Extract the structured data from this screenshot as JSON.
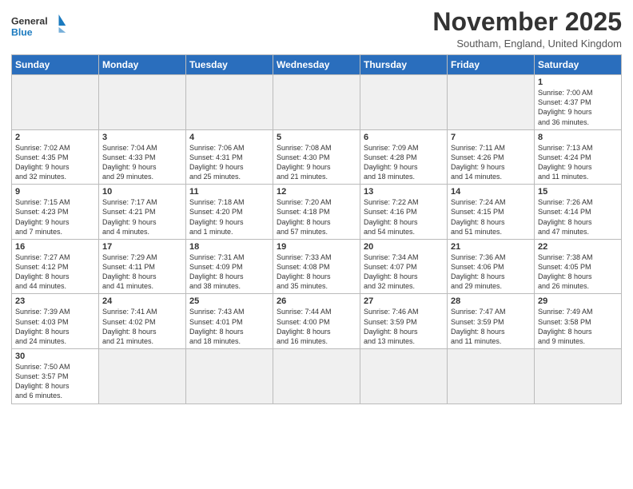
{
  "header": {
    "logo_general": "General",
    "logo_blue": "Blue",
    "title": "November 2025",
    "subtitle": "Southam, England, United Kingdom"
  },
  "days_of_week": [
    "Sunday",
    "Monday",
    "Tuesday",
    "Wednesday",
    "Thursday",
    "Friday",
    "Saturday"
  ],
  "weeks": [
    [
      {
        "day": "",
        "info": ""
      },
      {
        "day": "",
        "info": ""
      },
      {
        "day": "",
        "info": ""
      },
      {
        "day": "",
        "info": ""
      },
      {
        "day": "",
        "info": ""
      },
      {
        "day": "",
        "info": ""
      },
      {
        "day": "1",
        "info": "Sunrise: 7:00 AM\nSunset: 4:37 PM\nDaylight: 9 hours\nand 36 minutes."
      }
    ],
    [
      {
        "day": "2",
        "info": "Sunrise: 7:02 AM\nSunset: 4:35 PM\nDaylight: 9 hours\nand 32 minutes."
      },
      {
        "day": "3",
        "info": "Sunrise: 7:04 AM\nSunset: 4:33 PM\nDaylight: 9 hours\nand 29 minutes."
      },
      {
        "day": "4",
        "info": "Sunrise: 7:06 AM\nSunset: 4:31 PM\nDaylight: 9 hours\nand 25 minutes."
      },
      {
        "day": "5",
        "info": "Sunrise: 7:08 AM\nSunset: 4:30 PM\nDaylight: 9 hours\nand 21 minutes."
      },
      {
        "day": "6",
        "info": "Sunrise: 7:09 AM\nSunset: 4:28 PM\nDaylight: 9 hours\nand 18 minutes."
      },
      {
        "day": "7",
        "info": "Sunrise: 7:11 AM\nSunset: 4:26 PM\nDaylight: 9 hours\nand 14 minutes."
      },
      {
        "day": "8",
        "info": "Sunrise: 7:13 AM\nSunset: 4:24 PM\nDaylight: 9 hours\nand 11 minutes."
      }
    ],
    [
      {
        "day": "9",
        "info": "Sunrise: 7:15 AM\nSunset: 4:23 PM\nDaylight: 9 hours\nand 7 minutes."
      },
      {
        "day": "10",
        "info": "Sunrise: 7:17 AM\nSunset: 4:21 PM\nDaylight: 9 hours\nand 4 minutes."
      },
      {
        "day": "11",
        "info": "Sunrise: 7:18 AM\nSunset: 4:20 PM\nDaylight: 9 hours\nand 1 minute."
      },
      {
        "day": "12",
        "info": "Sunrise: 7:20 AM\nSunset: 4:18 PM\nDaylight: 8 hours\nand 57 minutes."
      },
      {
        "day": "13",
        "info": "Sunrise: 7:22 AM\nSunset: 4:16 PM\nDaylight: 8 hours\nand 54 minutes."
      },
      {
        "day": "14",
        "info": "Sunrise: 7:24 AM\nSunset: 4:15 PM\nDaylight: 8 hours\nand 51 minutes."
      },
      {
        "day": "15",
        "info": "Sunrise: 7:26 AM\nSunset: 4:14 PM\nDaylight: 8 hours\nand 47 minutes."
      }
    ],
    [
      {
        "day": "16",
        "info": "Sunrise: 7:27 AM\nSunset: 4:12 PM\nDaylight: 8 hours\nand 44 minutes."
      },
      {
        "day": "17",
        "info": "Sunrise: 7:29 AM\nSunset: 4:11 PM\nDaylight: 8 hours\nand 41 minutes."
      },
      {
        "day": "18",
        "info": "Sunrise: 7:31 AM\nSunset: 4:09 PM\nDaylight: 8 hours\nand 38 minutes."
      },
      {
        "day": "19",
        "info": "Sunrise: 7:33 AM\nSunset: 4:08 PM\nDaylight: 8 hours\nand 35 minutes."
      },
      {
        "day": "20",
        "info": "Sunrise: 7:34 AM\nSunset: 4:07 PM\nDaylight: 8 hours\nand 32 minutes."
      },
      {
        "day": "21",
        "info": "Sunrise: 7:36 AM\nSunset: 4:06 PM\nDaylight: 8 hours\nand 29 minutes."
      },
      {
        "day": "22",
        "info": "Sunrise: 7:38 AM\nSunset: 4:05 PM\nDaylight: 8 hours\nand 26 minutes."
      }
    ],
    [
      {
        "day": "23",
        "info": "Sunrise: 7:39 AM\nSunset: 4:03 PM\nDaylight: 8 hours\nand 24 minutes."
      },
      {
        "day": "24",
        "info": "Sunrise: 7:41 AM\nSunset: 4:02 PM\nDaylight: 8 hours\nand 21 minutes."
      },
      {
        "day": "25",
        "info": "Sunrise: 7:43 AM\nSunset: 4:01 PM\nDaylight: 8 hours\nand 18 minutes."
      },
      {
        "day": "26",
        "info": "Sunrise: 7:44 AM\nSunset: 4:00 PM\nDaylight: 8 hours\nand 16 minutes."
      },
      {
        "day": "27",
        "info": "Sunrise: 7:46 AM\nSunset: 3:59 PM\nDaylight: 8 hours\nand 13 minutes."
      },
      {
        "day": "28",
        "info": "Sunrise: 7:47 AM\nSunset: 3:59 PM\nDaylight: 8 hours\nand 11 minutes."
      },
      {
        "day": "29",
        "info": "Sunrise: 7:49 AM\nSunset: 3:58 PM\nDaylight: 8 hours\nand 9 minutes."
      }
    ],
    [
      {
        "day": "30",
        "info": "Sunrise: 7:50 AM\nSunset: 3:57 PM\nDaylight: 8 hours\nand 6 minutes."
      },
      {
        "day": "",
        "info": ""
      },
      {
        "day": "",
        "info": ""
      },
      {
        "day": "",
        "info": ""
      },
      {
        "day": "",
        "info": ""
      },
      {
        "day": "",
        "info": ""
      },
      {
        "day": "",
        "info": ""
      }
    ]
  ]
}
